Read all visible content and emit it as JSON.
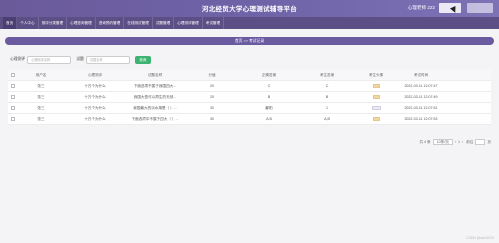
{
  "header": {
    "title": "河北经贸大学心理测试辅导平台",
    "user": "心理老师 222",
    "logout_label": "",
    "home_label": ""
  },
  "nav": [
    "首页",
    "个人中心",
    "测评分类管理",
    "心理咨询管理",
    "咨询预约管理",
    "在线测试管理",
    "试题管理",
    "心理测评管理",
    "考试管理"
  ],
  "breadcrumb": "首页  >>  考试记录",
  "search": {
    "label1": "心理测评",
    "placeholder1": "心理测评名称",
    "label2": "试题",
    "placeholder2": "试题名称",
    "button": "查询"
  },
  "table": {
    "headers": [
      "用户名",
      "心理测评",
      "试题名称",
      "分值",
      "正确答案",
      "考生答案",
      "考生头像",
      "考试时间"
    ],
    "rows": [
      [
        "张三",
        "十万个为什么",
        "下面选项不属于我国四大...",
        "20",
        "C",
        "C",
        "2022-03-11 12:07:47"
      ],
      [
        "张三",
        "十万个为什么",
        "我国大型可以再生的天然...",
        "20",
        "B",
        "B",
        "2022-03-11 12:07:49"
      ],
      [
        "张三",
        "十万个为什么",
        "我国最大的淡水湖是（ ）...",
        "30",
        "鄱阳",
        "1",
        "2022-03-11 12:07:51"
      ],
      [
        "张三",
        "十万个为什么",
        "下面选项中不属于四大（ ）...",
        "30",
        "A,B",
        "A,B",
        "2022-03-11 12:07:53"
      ]
    ]
  },
  "pager": {
    "total": "共 4 条",
    "page_size": "10条/页",
    "page": "1",
    "goto": "前往",
    "page_unit": "页"
  },
  "watermark": "CSDN @ssm2019"
}
